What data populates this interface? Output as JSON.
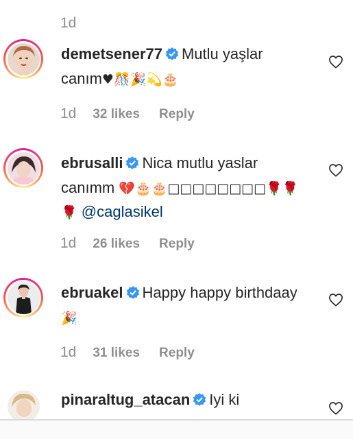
{
  "top_time": "1d",
  "comments": [
    {
      "username": "demetsener77",
      "text": "Mutlu yaşlar canım",
      "emojis": "♥🎊🎉💫🎂",
      "time": "1d",
      "likes": "32 likes",
      "reply": "Reply"
    },
    {
      "username": "ebrusalli",
      "text": "Nica mutlu yaslar canımm",
      "emojis": "💔🎂🎂□□□□□□□□🌹🌹",
      "emojis2": "🌹",
      "mention": "@caglasikel",
      "time": "1d",
      "likes": "26 likes",
      "reply": "Reply"
    },
    {
      "username": "ebruakel",
      "text": "Happy happy birthdaay",
      "emojis": "🎉",
      "time": "1d",
      "likes": "31 likes",
      "reply": "Reply"
    },
    {
      "username": "pinaraltug_atacan",
      "text": "Iyi ki"
    }
  ]
}
